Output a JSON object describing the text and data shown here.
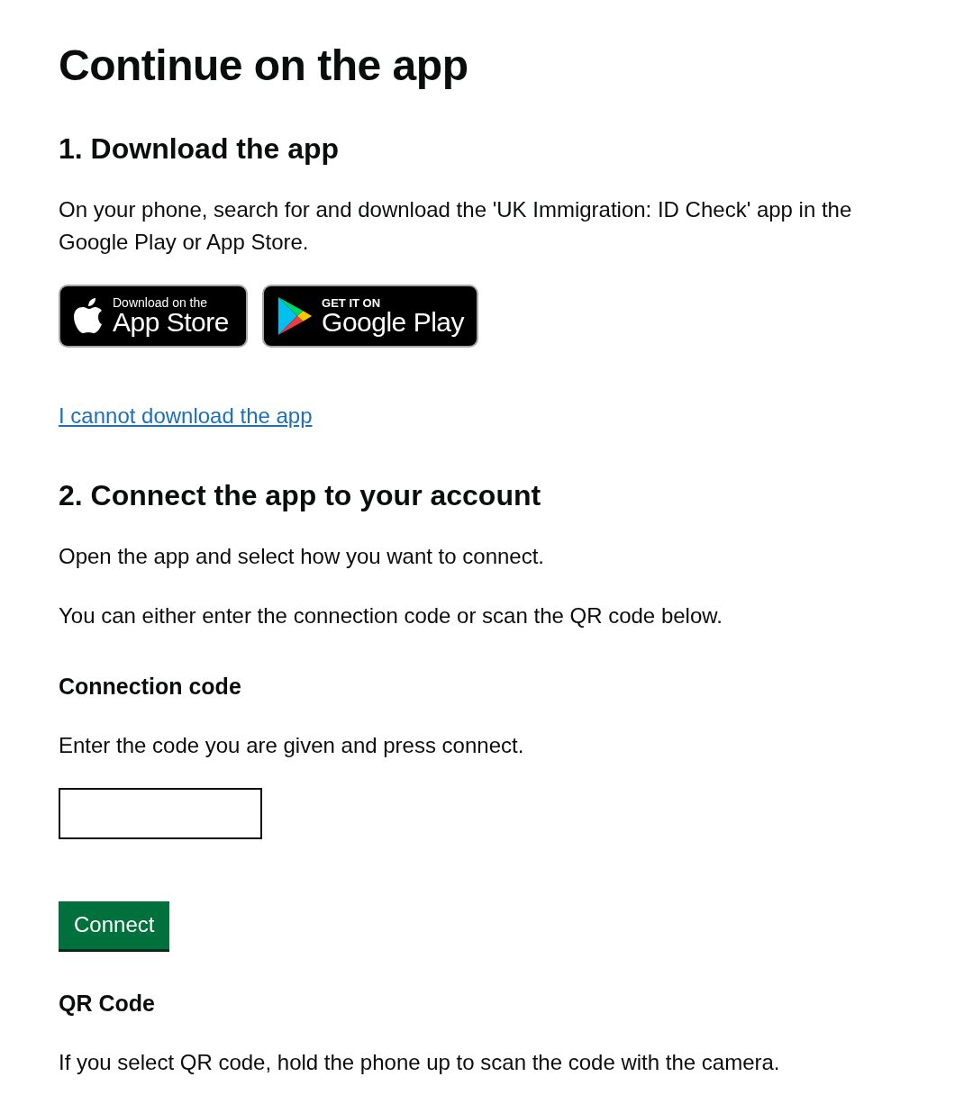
{
  "title": "Continue on the app",
  "blocks": [
    {
      "kind": "h2",
      "text": "1. Download the app"
    },
    {
      "kind": "p",
      "text": "On your phone, search for and download the 'UK Immigration: ID Check' app in the Google Play or App Store."
    },
    {
      "kind": "badges",
      "badges": [
        {
          "kind": "apple",
          "small": "Download on the",
          "large": "App Store"
        },
        {
          "kind": "google",
          "small": "GET IT ON",
          "large": "Google Play"
        }
      ]
    },
    {
      "kind": "link",
      "text": "I cannot download the app"
    },
    {
      "kind": "h2",
      "text": "2. Connect the app to your account"
    },
    {
      "kind": "p",
      "text": "Open the app and select how you want to connect."
    },
    {
      "kind": "p",
      "text": "You can either enter the connection code or scan the QR code below."
    },
    {
      "kind": "h3",
      "text": "Connection code"
    },
    {
      "kind": "p",
      "text": "Enter the code you are given and press connect."
    },
    {
      "kind": "input"
    },
    {
      "kind": "button",
      "text": "Connect"
    },
    {
      "kind": "h3",
      "text": "QR Code"
    },
    {
      "kind": "p",
      "text": "If you select QR code, hold the phone up to scan the code with the camera."
    }
  ]
}
